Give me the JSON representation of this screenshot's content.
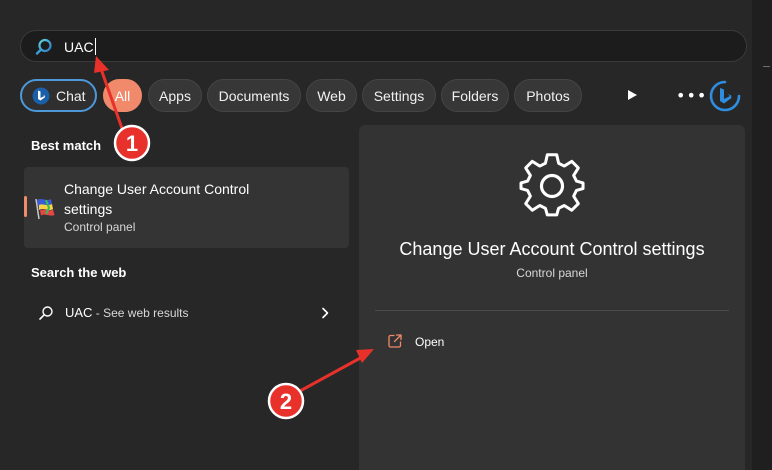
{
  "search": {
    "value": "UAC"
  },
  "filters": [
    {
      "label": "Chat"
    },
    {
      "label": "All"
    },
    {
      "label": "Apps"
    },
    {
      "label": "Documents"
    },
    {
      "label": "Web"
    },
    {
      "label": "Settings"
    },
    {
      "label": "Folders"
    },
    {
      "label": "Photos"
    }
  ],
  "best_match": {
    "section_title": "Best match",
    "title": "Change User Account Control settings",
    "subtitle": "Control panel"
  },
  "web": {
    "section_title": "Search the web",
    "query": "UAC",
    "suffix": " - See web results"
  },
  "detail": {
    "title": "Change User Account Control settings",
    "subtitle": "Control panel",
    "open_label": "Open"
  },
  "annotations": {
    "badge1": "1",
    "badge2": "2"
  },
  "colors": {
    "accent": "#f08a6a",
    "chat_border": "#4c98d8",
    "annotation_red": "#e8312a"
  },
  "icons": [
    "search-icon",
    "bing-chat-icon",
    "play-icon",
    "more-icon",
    "bing-icon",
    "uac-flag-icon",
    "web-search-icon",
    "chevron-right-icon",
    "gear-icon",
    "open-external-icon"
  ]
}
